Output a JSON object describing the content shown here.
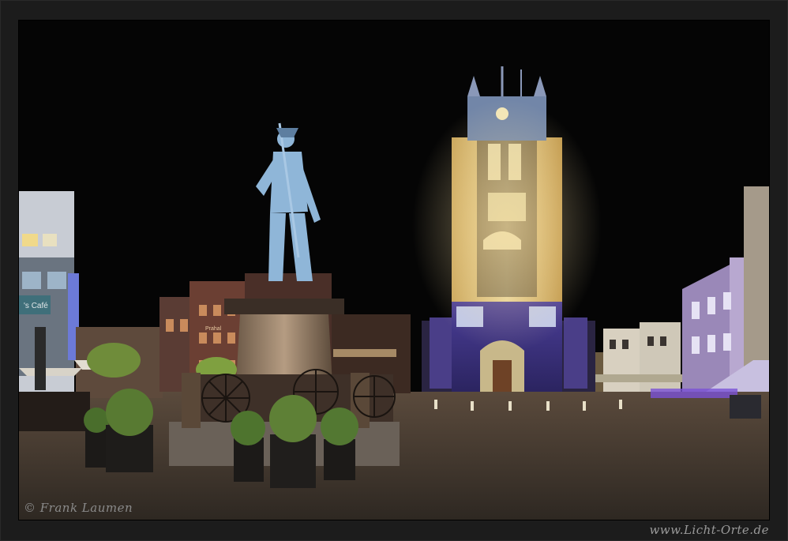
{
  "photo": {
    "subject": "night-square-with-statue-and-church",
    "sky_color": "#050505"
  },
  "signs": {
    "cafe_sign": "'s Café",
    "shop_sign": "Prahal"
  },
  "credits": {
    "copyright": "© Frank Laumen",
    "website": "www.Licht-Orte.de"
  },
  "colors": {
    "tower_gold": "#d6b46a",
    "tower_violet": "#6a5ab8",
    "statue_blue": "#8fb6d8",
    "cobble": "#3a332c"
  }
}
